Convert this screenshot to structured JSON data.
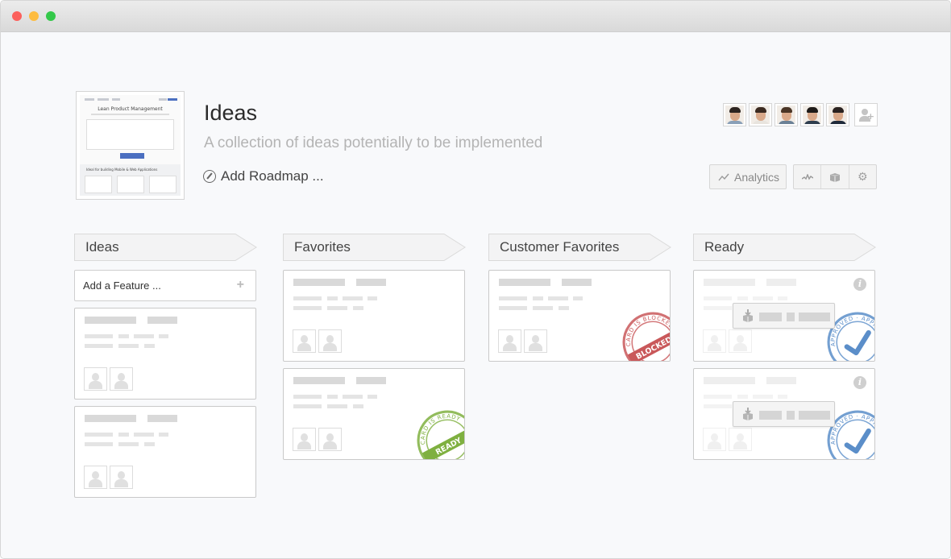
{
  "window": {
    "controls": [
      "close",
      "minimize",
      "maximize"
    ]
  },
  "header": {
    "thumbnail": {
      "title": "Lean Product Management",
      "section_title": "Ideal for building Mobile & Web Applications"
    },
    "title": "Ideas",
    "subtitle": "A collection of ideas potentially to be implemented",
    "add_roadmap_label": "Add Roadmap ...",
    "add_roadmap_icon": "compass-icon",
    "members": [
      {
        "name": "member-1",
        "shirt": "#8aa0b8",
        "hair": "#2d2420"
      },
      {
        "name": "member-2",
        "shirt": "#e8e4de",
        "hair": "#3b2a20"
      },
      {
        "name": "member-3",
        "shirt": "#6b8196",
        "hair": "#4a3526"
      },
      {
        "name": "member-4",
        "shirt": "#2e3e4e",
        "hair": "#1e1a18"
      },
      {
        "name": "member-5",
        "shirt": "#1f2a3a",
        "hair": "#2a2220"
      }
    ],
    "add_member_icon": "add-user-icon",
    "analytics_label": "Analytics",
    "analytics_icon": "line-chart-icon",
    "toolbar_icons": [
      "activity-icon",
      "box-icon",
      "gear-icon"
    ]
  },
  "lanes": [
    {
      "title": "Ideas",
      "add_feature_label": "Add a Feature ...",
      "add_feature_icon": "+",
      "cards": [
        {
          "stamp": null,
          "info": false,
          "popover": false
        },
        {
          "stamp": null,
          "info": false,
          "popover": false
        }
      ]
    },
    {
      "title": "Favorites",
      "cards": [
        {
          "stamp": null,
          "info": false,
          "popover": false
        },
        {
          "stamp": {
            "type": "ready",
            "ring_text": "CARD IS READY",
            "label": "READY",
            "color": "#7fb040"
          },
          "info": false,
          "popover": false
        }
      ]
    },
    {
      "title": "Customer Favorites",
      "cards": [
        {
          "stamp": {
            "type": "blocked",
            "ring_text": "CARD IS BLOCKED",
            "label": "BLOCKED",
            "color": "#c9585a"
          },
          "info": false,
          "popover": false
        }
      ]
    },
    {
      "title": "Ready",
      "cards": [
        {
          "stamp": {
            "type": "approved",
            "ring_text": "APPROVED · APPROVED ·",
            "label": "",
            "color": "#5b8ec9"
          },
          "info": true,
          "popover": true
        },
        {
          "stamp": {
            "type": "approved",
            "ring_text": "APPROVED · APPROVED ·",
            "label": "",
            "color": "#5b8ec9"
          },
          "info": true,
          "popover": true
        }
      ]
    }
  ],
  "info_icon_glyph": "i"
}
